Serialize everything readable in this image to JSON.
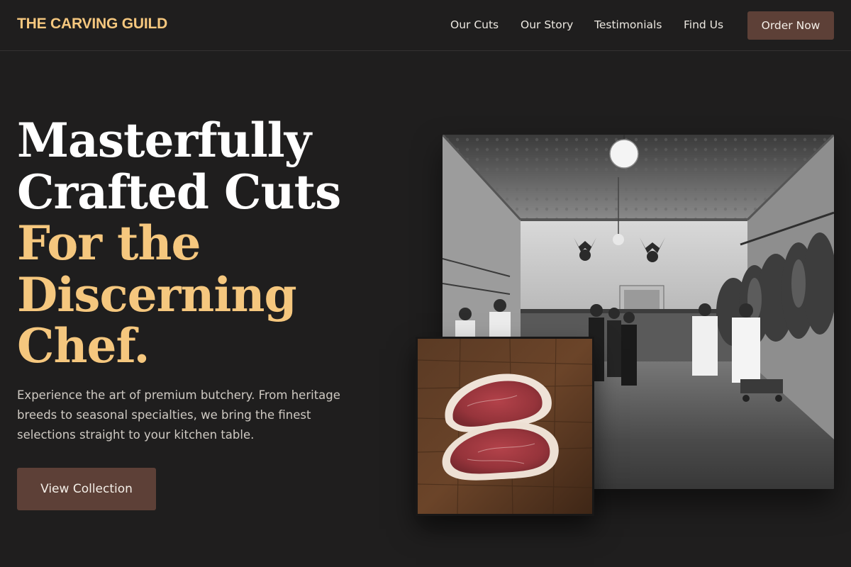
{
  "nav": {
    "brand": "THE CARVING GUILD",
    "links": [
      {
        "label": "Our Cuts"
      },
      {
        "label": "Our Story"
      },
      {
        "label": "Testimonials"
      },
      {
        "label": "Find Us"
      }
    ],
    "order_label": "Order Now"
  },
  "hero": {
    "headline_lines_white": [
      "Masterfully",
      "Crafted Cuts"
    ],
    "headline_lines_gold": [
      "For the",
      "Discerning",
      "Chef."
    ],
    "description": "Experience the art of premium butchery. From heritage breeds to seasonal specialties, we bring the finest selections straight to your kitchen table.",
    "cta_label": "View Collection"
  },
  "colors": {
    "background": "#1f1e1e",
    "accent_gold": "#f5c77e",
    "button_brown": "#5d4037",
    "text_light": "#f2efe9"
  },
  "images": {
    "main": "vintage-butcher-shop-photo",
    "inset": "raw-steaks-on-wood-photo"
  }
}
